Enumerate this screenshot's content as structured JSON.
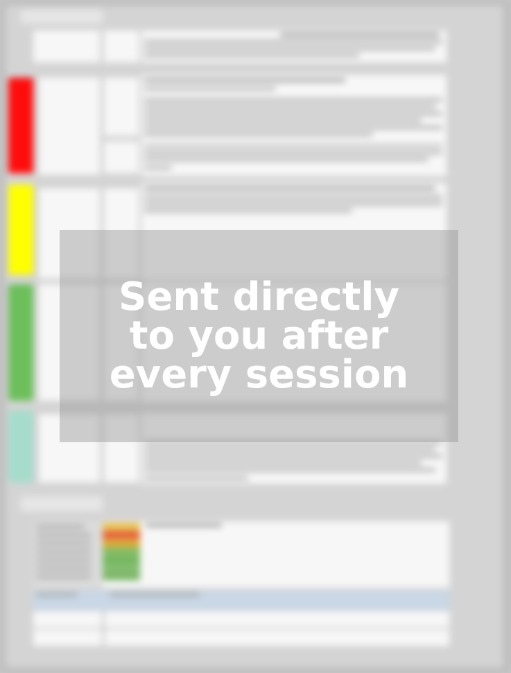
{
  "overlay": {
    "lines": [
      "Sent directly",
      "to you after",
      "every session"
    ],
    "text_color": "#ffffff"
  },
  "report": {
    "status_colors": {
      "red": "#ff0d0d",
      "yellow": "#ffff00",
      "green": "#6cbf5b",
      "teal": "#a5dccb"
    },
    "legend_colors": [
      "#e8c14a",
      "#e5552b",
      "#d9a52a",
      "#7cb85a",
      "#6bb152",
      "#79b864",
      "#73b15e"
    ]
  }
}
